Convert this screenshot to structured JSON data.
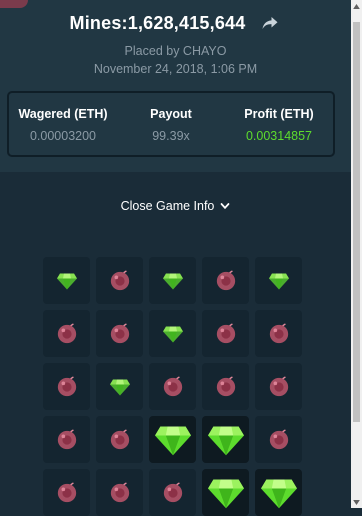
{
  "title": "Mines:1,628,415,644",
  "placed_by": "Placed by CHAYO",
  "date": "November 24, 2018, 1:06 PM",
  "stats": {
    "wagered_label": "Wagered (ETH)",
    "wagered_value": "0.00003200",
    "payout_label": "Payout",
    "payout_value": "99.39x",
    "profit_label": "Profit (ETH)",
    "profit_value": "0.00314857"
  },
  "toggle_label": "Close Game Info",
  "colors": {
    "background": "#1a2c38",
    "panel": "#213743",
    "profit": "#5ddc2d",
    "gem": "#5ddc2d",
    "mine": "#c0566c"
  },
  "icons": {
    "share": "share-arrow-icon",
    "toggle": "chevron-down-icon",
    "gem": "gem-icon",
    "mine": "mine-icon"
  },
  "board": [
    [
      "gem-dim",
      "mine",
      "gem-dim",
      "mine",
      "gem-dim"
    ],
    [
      "mine",
      "mine",
      "gem-dim",
      "mine",
      "mine"
    ],
    [
      "mine",
      "gem-dim",
      "mine",
      "mine",
      "mine"
    ],
    [
      "mine",
      "mine",
      "gem-big",
      "gem-big",
      "mine"
    ],
    [
      "mine",
      "mine",
      "mine",
      "gem-big",
      "gem-big"
    ]
  ]
}
